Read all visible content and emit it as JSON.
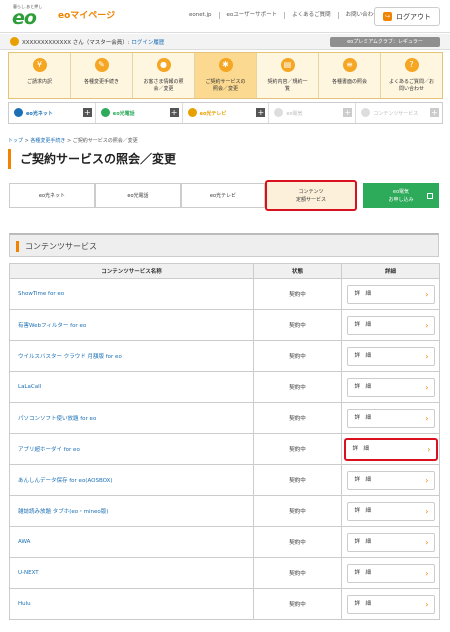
{
  "header": {
    "logo_tagline": "暮らし あと押し",
    "logo_text": "eo",
    "brand": "eoマイページ",
    "links": [
      "eonet.jp",
      "eoユーザーサポート",
      "よくあるご質問",
      "お問い合わせ"
    ],
    "logout_label": "ログアウト"
  },
  "userbar": {
    "name": "XXXXXXXXXXXXX さん（マスター会員）",
    "login_history": "ログイン履歴",
    "premium": "eoプレミアムクラブ：レギュラー"
  },
  "menu": [
    {
      "label": "ご請求内訳",
      "icon": "yen-icon"
    },
    {
      "label": "各種変更手続き",
      "icon": "pencil-icon"
    },
    {
      "label": "お客さま情報の照\n会／変更",
      "icon": "person-icon"
    },
    {
      "label": "ご契約サービスの\n照会／変更",
      "icon": "service-icon"
    },
    {
      "label": "契約内容／規約一\n覧",
      "icon": "document-icon"
    },
    {
      "label": "各種書面の照会",
      "icon": "list-icon"
    },
    {
      "label": "よくあるご質問／お\n問い合わせ",
      "icon": "question-icon"
    }
  ],
  "services": [
    {
      "label": "eo光ネット",
      "color": "#1a6fb5"
    },
    {
      "label": "eo光電話",
      "color": "#2daa5a"
    },
    {
      "label": "eo光テレビ",
      "color": "#e8a000"
    },
    {
      "label": "eo電気",
      "color": "#bbbbbb"
    },
    {
      "label": "コンテンツサービス",
      "color": "#bbbbbb"
    }
  ],
  "breadcrumb": {
    "top": "トップ",
    "sep1": " > ",
    "procedures": "各種変更手続き",
    "sep2": " > ",
    "current": "ご契約サービスの照会／変更"
  },
  "page_title": "ご契約サービスの照会／変更",
  "tabs": {
    "net": "eo光ネット",
    "phone": "eo光電話",
    "tv": "eo光テレビ",
    "contents": "コンテンツ\n定額サービス",
    "denki": "eo電気\nお申し込み"
  },
  "section_title": "コンテンツサービス",
  "table": {
    "headers": [
      "コンテンツサービス名称",
      "状態",
      "詳細"
    ],
    "detail_label": "詳　細",
    "rows": [
      {
        "name": "ShowTime for eo",
        "status": "契約中"
      },
      {
        "name": "有害Webフィルター for eo",
        "status": "契約中"
      },
      {
        "name": "ウイルスバスター クラウド 月額版 for eo",
        "status": "契約中"
      },
      {
        "name": "LaLaCall",
        "status": "契約中"
      },
      {
        "name": "パソコンソフト使い放題 for eo",
        "status": "契約中"
      },
      {
        "name": "アプリ超ホーダイ for eo",
        "status": "契約中"
      },
      {
        "name": "あんしんデータ保存 for eo(AOSBOX)",
        "status": "契約中"
      },
      {
        "name": "雑誌読み放題 タブホ(eo・mineo版)",
        "status": "契約中"
      },
      {
        "name": "AWA",
        "status": "契約中"
      },
      {
        "name": "U-NEXT",
        "status": "契約中"
      },
      {
        "name": "Hulu",
        "status": "契約中"
      }
    ]
  },
  "colors": {
    "accent": "#f08300",
    "eo_green": "#2f9e3a",
    "highlight_red": "#d9101e",
    "link_blue": "#1a6fb5"
  }
}
